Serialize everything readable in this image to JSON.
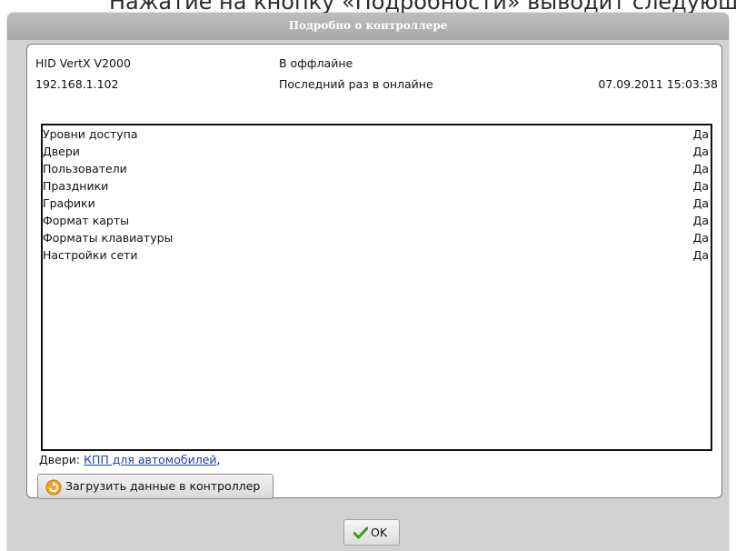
{
  "document": {
    "line": "Нажатие на кнопку «Подробности» выводит следующ"
  },
  "dialog": {
    "title": "Подробно о контроллере",
    "controller_model": "HID VertX V2000",
    "status": "В оффлайне",
    "ip_address": "192.168.1.102",
    "last_online_label": "Последний раз в онлайне",
    "last_online_time": "07.09.2011 15:03:38",
    "items": [
      {
        "name": "Уровни доступа",
        "value": "Да"
      },
      {
        "name": "Двери",
        "value": "Да"
      },
      {
        "name": "Пользователи",
        "value": "Да"
      },
      {
        "name": "Праздники",
        "value": "Да"
      },
      {
        "name": "Графики",
        "value": "Да"
      },
      {
        "name": "Формат карты",
        "value": "Да"
      },
      {
        "name": "Форматы клавиатуры",
        "value": "Да"
      },
      {
        "name": "Настройки сети",
        "value": "Да"
      }
    ],
    "doors_label": "Двери:",
    "doors_link": "КПП для автомобилей",
    "doors_suffix": ",",
    "upload_button": "Загрузить данные в контроллер",
    "upload_icon": "refresh-arrow-icon",
    "ok_button": "OK",
    "ok_icon": "checkmark-icon"
  }
}
